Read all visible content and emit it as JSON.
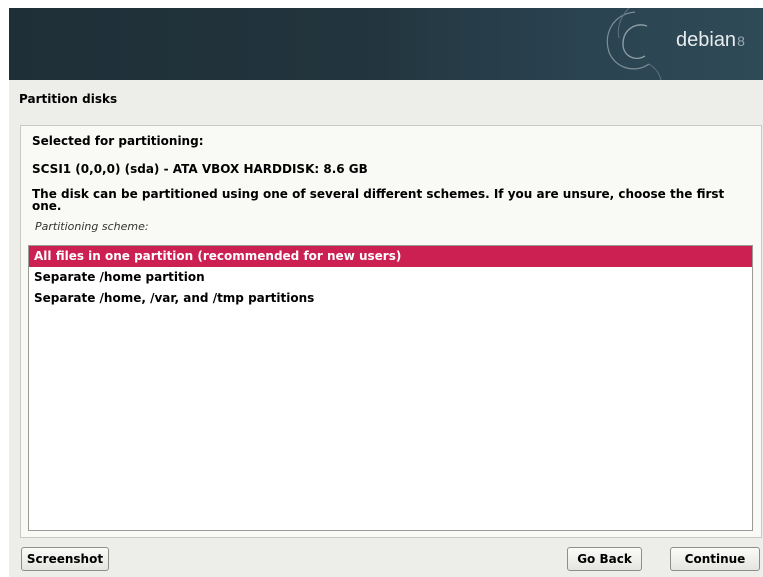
{
  "banner": {
    "logo_text": "debian",
    "logo_version": "8"
  },
  "page": {
    "title": "Partition disks"
  },
  "content": {
    "selected_heading": "Selected for partitioning:",
    "disk_name": "SCSI1 (0,0,0) (sda) - ATA VBOX HARDDISK: 8.6 GB",
    "description": "The disk can be partitioned using one of several different schemes. If you are unsure, choose the first one.",
    "scheme_label": "Partitioning scheme:",
    "options": [
      {
        "label": "All files in one partition (recommended for new users)",
        "selected": true
      },
      {
        "label": "Separate /home partition",
        "selected": false
      },
      {
        "label": "Separate /home, /var, and /tmp partitions",
        "selected": false
      }
    ]
  },
  "buttons": {
    "screenshot": "Screenshot",
    "go_back": "Go Back",
    "continue": "Continue"
  },
  "colors": {
    "selection": "#cc1f52",
    "banner": "#22343d",
    "background": "#ededea"
  }
}
